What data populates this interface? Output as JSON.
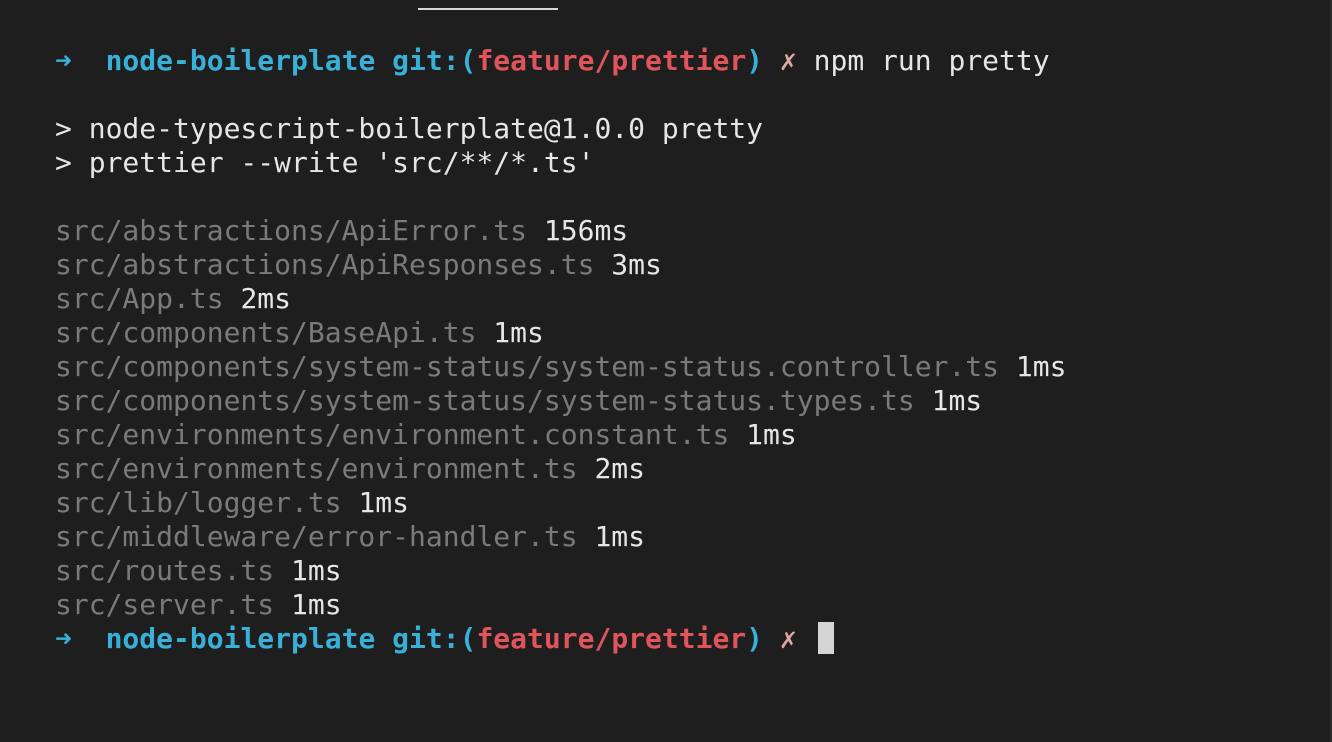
{
  "prompt": {
    "arrow": "➜",
    "cwd": "node-boilerplate",
    "git_open": "git:(",
    "branch": "feature/prettier",
    "git_close": ")",
    "dirty": "✗"
  },
  "command": "npm run pretty",
  "npm_output": [
    "> node-typescript-boilerplate@1.0.0 pretty",
    "> prettier --write 'src/**/*.ts'"
  ],
  "files": [
    {
      "path": "src/abstractions/ApiError.ts",
      "time": "156ms"
    },
    {
      "path": "src/abstractions/ApiResponses.ts",
      "time": "3ms"
    },
    {
      "path": "src/App.ts",
      "time": "2ms"
    },
    {
      "path": "src/components/BaseApi.ts",
      "time": "1ms"
    },
    {
      "path": "src/components/system-status/system-status.controller.ts",
      "time": "1ms"
    },
    {
      "path": "src/components/system-status/system-status.types.ts",
      "time": "1ms"
    },
    {
      "path": "src/environments/environment.constant.ts",
      "time": "1ms"
    },
    {
      "path": "src/environments/environment.ts",
      "time": "2ms"
    },
    {
      "path": "src/lib/logger.ts",
      "time": "1ms"
    },
    {
      "path": "src/middleware/error-handler.ts",
      "time": "1ms"
    },
    {
      "path": "src/routes.ts",
      "time": "1ms"
    },
    {
      "path": "src/server.ts",
      "time": "1ms"
    }
  ]
}
